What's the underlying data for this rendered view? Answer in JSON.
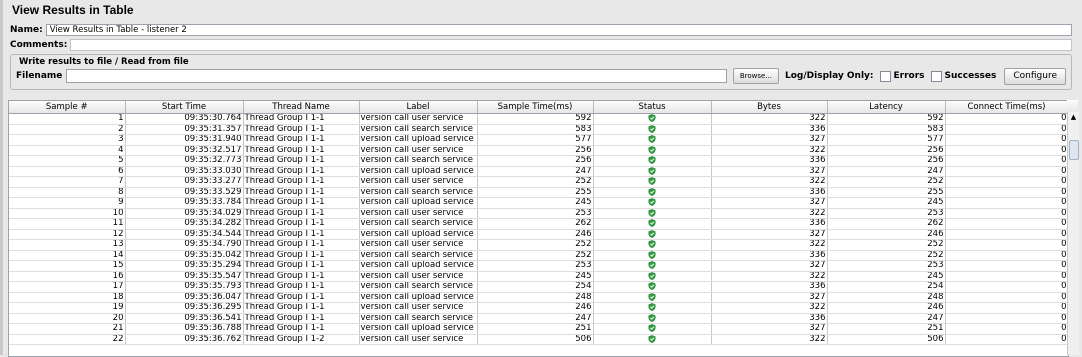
{
  "panel": {
    "title": "View Results in Table",
    "name_label": "Name:",
    "name_value": "View Results in Table - listener 2",
    "comments_label": "Comments:",
    "file_section_title": "Write results to file / Read from file",
    "filename_label": "Filename",
    "filename_value": "",
    "browse_label": "Browse...",
    "log_display_label": "Log/Display Only:",
    "errors_label": "Errors",
    "successes_label": "Successes",
    "configure_label": "Configure"
  },
  "table": {
    "headers": [
      "Sample #",
      "Start Time",
      "Thread Name",
      "Label",
      "Sample Time(ms)",
      "Status",
      "Bytes",
      "Latency",
      "Connect Time(ms)"
    ],
    "rows": [
      [
        "1",
        "09:35:30.764",
        "Thread Group I 1-1",
        "version call user service",
        "592",
        "success",
        "322",
        "592",
        "0"
      ],
      [
        "2",
        "09:35:31.357",
        "Thread Group I 1-1",
        "version call search service",
        "583",
        "success",
        "336",
        "583",
        "0"
      ],
      [
        "3",
        "09:35:31.940",
        "Thread Group I 1-1",
        "version call upload service",
        "577",
        "success",
        "327",
        "577",
        "0"
      ],
      [
        "4",
        "09:35:32.517",
        "Thread Group I 1-1",
        "version call user service",
        "256",
        "success",
        "322",
        "256",
        "0"
      ],
      [
        "5",
        "09:35:32.773",
        "Thread Group I 1-1",
        "version call search service",
        "256",
        "success",
        "336",
        "256",
        "0"
      ],
      [
        "6",
        "09:35:33.030",
        "Thread Group I 1-1",
        "version call upload service",
        "247",
        "success",
        "327",
        "247",
        "0"
      ],
      [
        "7",
        "09:35:33.277",
        "Thread Group I 1-1",
        "version call user service",
        "252",
        "success",
        "322",
        "252",
        "0"
      ],
      [
        "8",
        "09:35:33.529",
        "Thread Group I 1-1",
        "version call search service",
        "255",
        "success",
        "336",
        "255",
        "0"
      ],
      [
        "9",
        "09:35:33.784",
        "Thread Group I 1-1",
        "version call upload service",
        "245",
        "success",
        "327",
        "245",
        "0"
      ],
      [
        "10",
        "09:35:34.029",
        "Thread Group I 1-1",
        "version call user service",
        "253",
        "success",
        "322",
        "253",
        "0"
      ],
      [
        "11",
        "09:35:34.282",
        "Thread Group I 1-1",
        "version call search service",
        "262",
        "success",
        "336",
        "262",
        "0"
      ],
      [
        "12",
        "09:35:34.544",
        "Thread Group I 1-1",
        "version call upload service",
        "246",
        "success",
        "327",
        "246",
        "0"
      ],
      [
        "13",
        "09:35:34.790",
        "Thread Group I 1-1",
        "version call user service",
        "252",
        "success",
        "322",
        "252",
        "0"
      ],
      [
        "14",
        "09:35:35.042",
        "Thread Group I 1-1",
        "version call search service",
        "252",
        "success",
        "336",
        "252",
        "0"
      ],
      [
        "15",
        "09:35:35.294",
        "Thread Group I 1-1",
        "version call upload service",
        "253",
        "success",
        "327",
        "253",
        "0"
      ],
      [
        "16",
        "09:35:35.547",
        "Thread Group I 1-1",
        "version call user service",
        "245",
        "success",
        "322",
        "245",
        "0"
      ],
      [
        "17",
        "09:35:35.793",
        "Thread Group I 1-1",
        "version call search service",
        "254",
        "success",
        "336",
        "254",
        "0"
      ],
      [
        "18",
        "09:35:36.047",
        "Thread Group I 1-1",
        "version call upload service",
        "248",
        "success",
        "327",
        "248",
        "0"
      ],
      [
        "19",
        "09:35:36.295",
        "Thread Group I 1-1",
        "version call user service",
        "246",
        "success",
        "322",
        "246",
        "0"
      ],
      [
        "20",
        "09:35:36.541",
        "Thread Group I 1-1",
        "version call search service",
        "247",
        "success",
        "336",
        "247",
        "0"
      ],
      [
        "21",
        "09:35:36.788",
        "Thread Group I 1-1",
        "version call upload service",
        "251",
        "success",
        "327",
        "251",
        "0"
      ],
      [
        "22",
        "09:35:36.762",
        "Thread Group I 1-2",
        "version call user service",
        "506",
        "success",
        "322",
        "506",
        "0"
      ]
    ]
  },
  "colors": {
    "success": "#2e9e3e",
    "accent": "#9fb3c8"
  },
  "icons": {
    "status": "green-shield-check-icon"
  }
}
